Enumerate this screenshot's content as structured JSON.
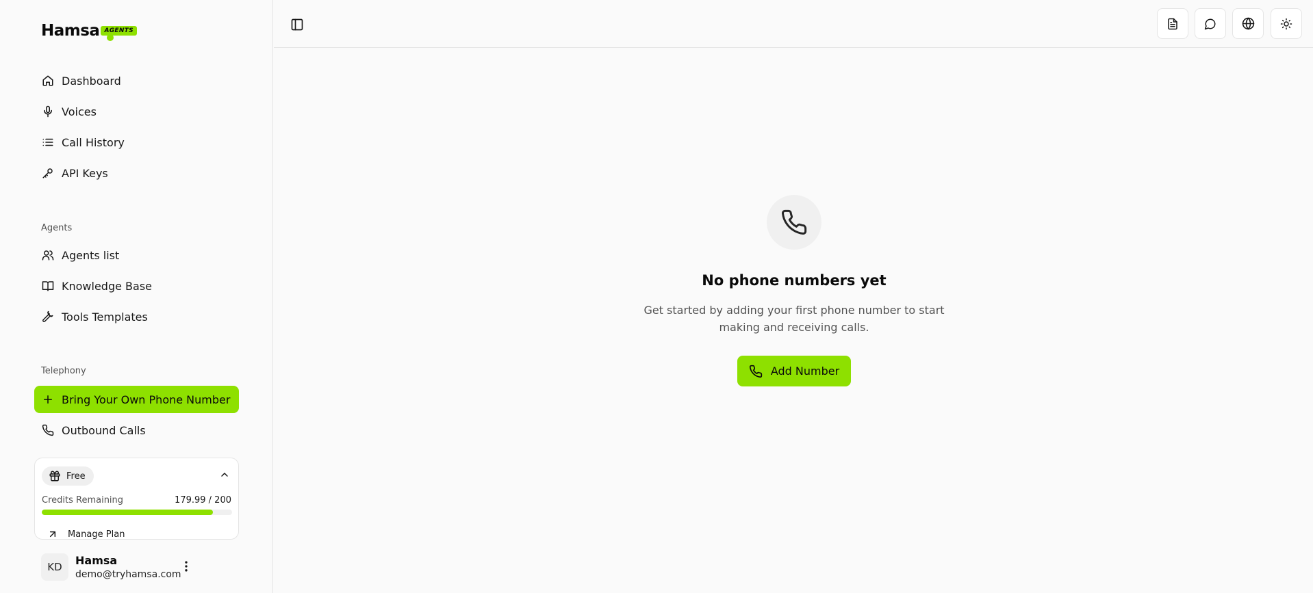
{
  "brand": {
    "name": "Hamsa",
    "badge": "AGENTS",
    "accent_color": "#8ee000"
  },
  "nav": {
    "main": [
      {
        "label": "Dashboard",
        "icon": "home-icon"
      },
      {
        "label": "Voices",
        "icon": "microphone-icon"
      },
      {
        "label": "Call History",
        "icon": "list-icon"
      },
      {
        "label": "API Keys",
        "icon": "key-icon"
      }
    ],
    "agents_section": "Agents",
    "agents": [
      {
        "label": "Agents list",
        "icon": "users-icon"
      },
      {
        "label": "Knowledge Base",
        "icon": "book-icon"
      },
      {
        "label": "Tools Templates",
        "icon": "wrench-icon"
      }
    ],
    "telephony_section": "Telephony",
    "telephony": [
      {
        "label": "Bring Your Own Phone Number",
        "icon": "plus-icon",
        "active": true
      },
      {
        "label": "Outbound Calls",
        "icon": "phone-icon",
        "active": false
      }
    ]
  },
  "plan": {
    "name": "Free",
    "credits_label": "Credits Remaining",
    "credits_value": "179.99 / 200",
    "credits_fraction": 0.89995,
    "manage_label": "Manage Plan"
  },
  "user": {
    "initials": "KD",
    "name": "Hamsa",
    "email": "demo@tryhamsa.com"
  },
  "topbar": {
    "buttons": [
      "document-icon",
      "chat-icon",
      "globe-icon",
      "sun-icon"
    ]
  },
  "empty_state": {
    "title": "No phone numbers yet",
    "description": "Get started by adding your first phone number to start making and receiving calls.",
    "button_label": "Add Number"
  }
}
